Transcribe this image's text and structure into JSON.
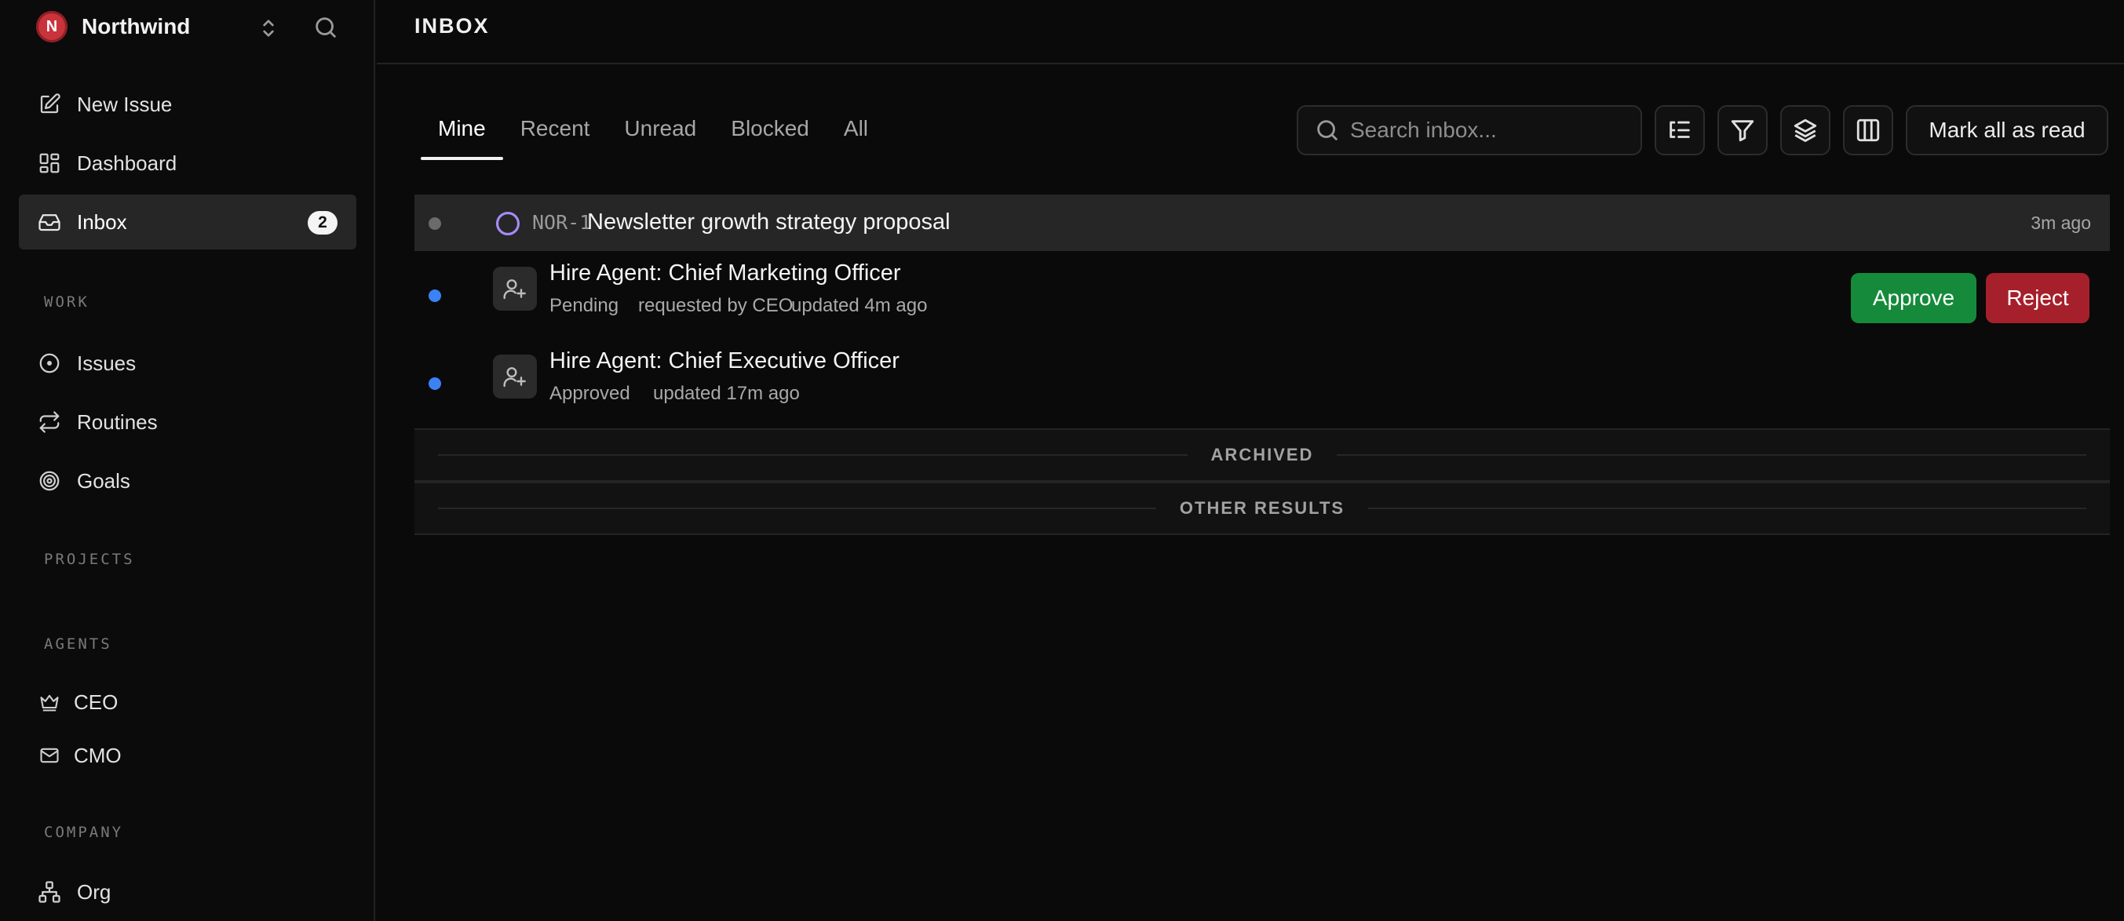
{
  "workspace": {
    "initial": "N",
    "name": "Northwind"
  },
  "nav": {
    "new_issue": "New Issue",
    "dashboard": "Dashboard",
    "inbox": "Inbox",
    "inbox_count": "2"
  },
  "sections": {
    "work": "WORK",
    "projects": "PROJECTS",
    "agents": "AGENTS",
    "company": "COMPANY"
  },
  "work_items": {
    "issues": "Issues",
    "routines": "Routines",
    "goals": "Goals"
  },
  "agents": {
    "ceo": "CEO",
    "cmo": "CMO"
  },
  "company_items": {
    "org": "Org"
  },
  "header": {
    "title": "INBOX"
  },
  "tabs": [
    "Mine",
    "Recent",
    "Unread",
    "Blocked",
    "All"
  ],
  "search": {
    "placeholder": "Search inbox..."
  },
  "toolbar": {
    "mark_all": "Mark all as read"
  },
  "items": [
    {
      "id": "NOR-1",
      "title": "Newsletter growth strategy proposal",
      "time": "3m ago",
      "unread": false
    },
    {
      "title": "Hire Agent: Chief Marketing Officer",
      "status": "Pending",
      "requested": "requested by CEO",
      "updated": "updated 4m ago",
      "unread": true
    },
    {
      "title": "Hire Agent: Chief Executive Officer",
      "status": "Approved",
      "updated": "updated 17m ago",
      "unread": true
    }
  ],
  "actions": {
    "approve": "Approve",
    "reject": "Reject"
  },
  "dividers": {
    "archived": "ARCHIVED",
    "other": "OTHER RESULTS"
  },
  "colors": {
    "accent_unread": "#3b82f6",
    "read_dot": "#6b6b6b",
    "approve": "#158a3b",
    "reject": "#a6202b",
    "issue_status": "#a78bfa",
    "logo": "#c8333c"
  },
  "icons": {
    "sidebar": [
      "pencil-square-icon",
      "dashboard-grid-icon",
      "inbox-tray-icon",
      "circle-dot-icon",
      "repeat-arrows-icon",
      "target-icon",
      "crown-icon",
      "mail-icon",
      "org-chart-icon"
    ],
    "toolbar": [
      "search-icon",
      "list-tree-icon",
      "filter-icon",
      "layers-icon",
      "columns-icon"
    ]
  }
}
